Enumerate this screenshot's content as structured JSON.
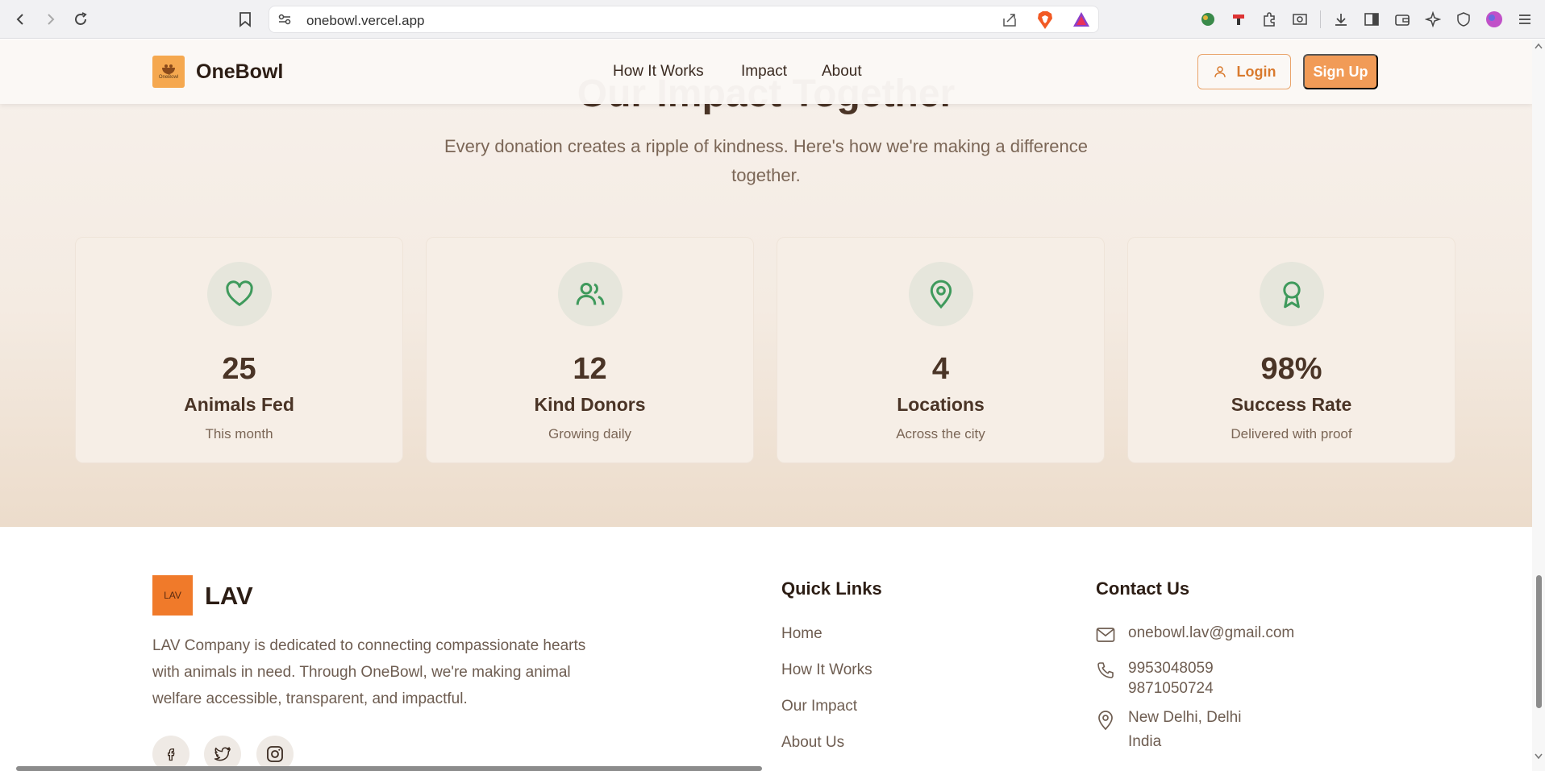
{
  "browser": {
    "url": "onebowl.vercel.app"
  },
  "header": {
    "brand": "OneBowl",
    "logo_text": "OneBowl",
    "nav": [
      "How It Works",
      "Impact",
      "About"
    ],
    "login_label": "Login",
    "signup_label": "Sign Up"
  },
  "impact": {
    "title": "Our Impact Together",
    "subtitle": "Every donation creates a ripple of kindness. Here's how we're making a difference together.",
    "stats": [
      {
        "icon": "heart-icon",
        "value": "25",
        "label": "Animals Fed",
        "note": "This month"
      },
      {
        "icon": "users-icon",
        "value": "12",
        "label": "Kind Donors",
        "note": "Growing daily"
      },
      {
        "icon": "map-pin-icon",
        "value": "4",
        "label": "Locations",
        "note": "Across the city"
      },
      {
        "icon": "award-icon",
        "value": "98%",
        "label": "Success Rate",
        "note": "Delivered with proof"
      }
    ]
  },
  "footer": {
    "company_logo": "LAV",
    "company_name": "LAV",
    "description": "LAV Company is dedicated to connecting compassionate hearts with animals in need. Through OneBowl, we're making animal welfare accessible, transparent, and impactful.",
    "quick_links_title": "Quick Links",
    "quick_links": [
      "Home",
      "How It Works",
      "Our Impact",
      "About Us"
    ],
    "contact_title": "Contact Us",
    "email": "onebowl.lav@gmail.com",
    "phone1": "9953048059",
    "phone2": "9871050724",
    "city": "New Delhi, Delhi",
    "country": "India"
  },
  "colors": {
    "accent": "#f19b57",
    "icon_green": "#3f9a5c",
    "text_dark": "#4a3426"
  }
}
